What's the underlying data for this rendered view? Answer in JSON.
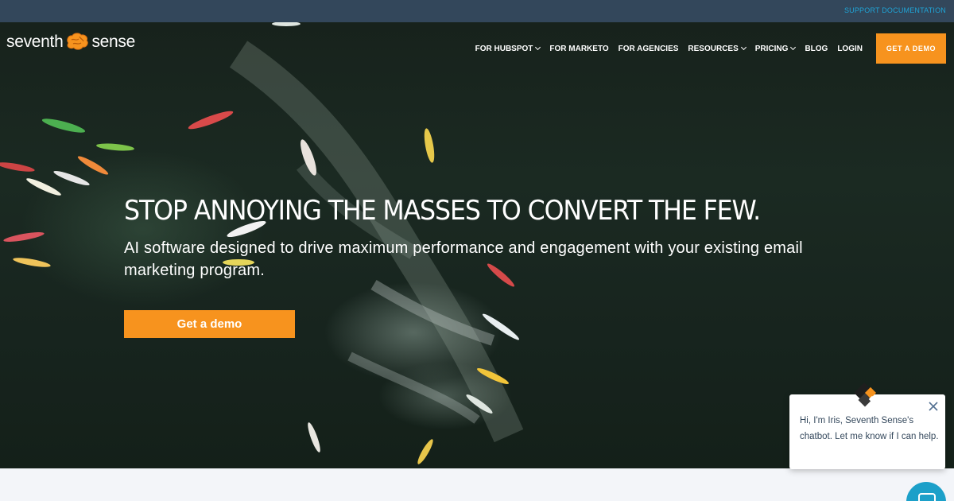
{
  "topbar": {
    "support_label": "SUPPORT DOCUMENTATION"
  },
  "logo": {
    "left_text": "seventh",
    "right_text": "sense",
    "icon": "brain-icon"
  },
  "nav": {
    "items": [
      {
        "label": "FOR HUBSPOT",
        "dropdown": true
      },
      {
        "label": "FOR MARKETO",
        "dropdown": false
      },
      {
        "label": "FOR AGENCIES",
        "dropdown": false
      },
      {
        "label": "RESOURCES",
        "dropdown": true
      },
      {
        "label": "PRICING",
        "dropdown": true
      },
      {
        "label": "BLOG",
        "dropdown": false
      },
      {
        "label": "LOGIN",
        "dropdown": false
      }
    ],
    "cta_label": "GET A DEMO"
  },
  "hero": {
    "headline": "STOP ANNOYING THE MASSES TO CONVERT THE FEW.",
    "subtext": "AI software designed to drive maximum performance and engagement with your existing email marketing program.",
    "cta_label": "Get a demo"
  },
  "chat": {
    "message": "Hi, I'm Iris, Seventh Sense's chatbot. Let me know if I can help."
  },
  "colors": {
    "accent": "#f7931e",
    "topbar": "#33475b",
    "support_link": "#1fa4d6",
    "chat_launcher": "#1ca0c9"
  }
}
